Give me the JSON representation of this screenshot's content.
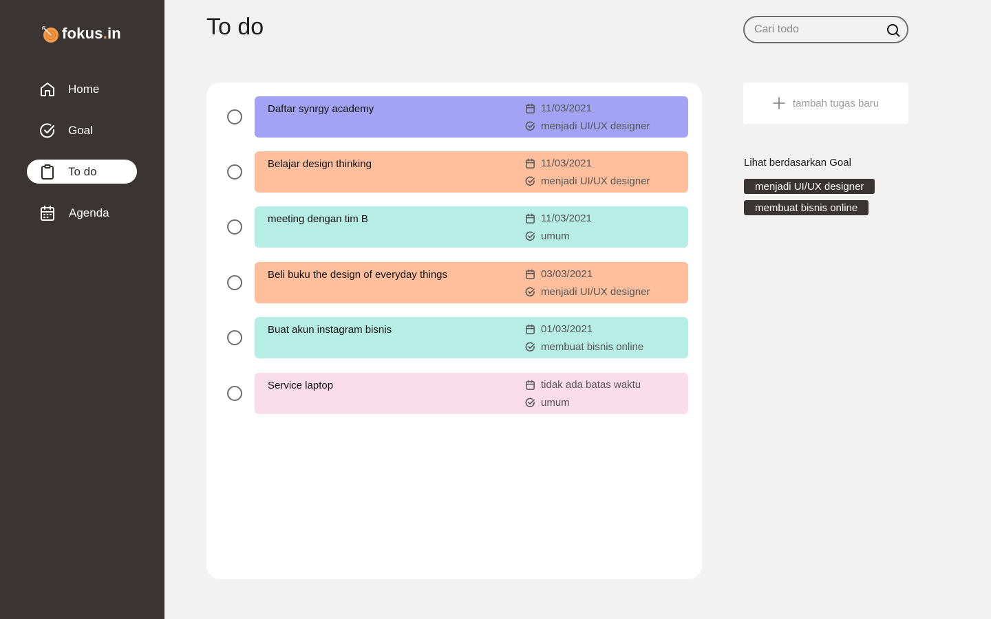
{
  "app": {
    "name_main": "fokus",
    "name_dot": ".",
    "name_suffix": "in"
  },
  "sidebar": {
    "items": [
      {
        "label": "Home",
        "icon": "home-icon",
        "active": false
      },
      {
        "label": "Goal",
        "icon": "check-circle-icon",
        "active": false
      },
      {
        "label": "To do",
        "icon": "clipboard-icon",
        "active": true
      },
      {
        "label": "Agenda",
        "icon": "calendar-icon",
        "active": false
      }
    ]
  },
  "header": {
    "title": "To do",
    "search_placeholder": "Cari todo"
  },
  "todos": [
    {
      "title": "Daftar synrgy academy",
      "date": "11/03/2021",
      "goal": "menjadi UI/UX designer",
      "color": "#a3a3f5"
    },
    {
      "title": "Belajar design thinking",
      "date": "11/03/2021",
      "goal": "menjadi UI/UX designer",
      "color": "#ffbf9d"
    },
    {
      "title": "meeting dengan tim B",
      "date": "11/03/2021",
      "goal": "umum",
      "color": "#b6ede5"
    },
    {
      "title": "Beli buku the design of everyday things",
      "date": "03/03/2021",
      "goal": "menjadi UI/UX designer",
      "color": "#ffbf9d"
    },
    {
      "title": "Buat akun instagram bisnis",
      "date": "01/03/2021",
      "goal": "membuat bisnis online",
      "color": "#b6ede5"
    },
    {
      "title": "Service laptop",
      "date": "tidak ada batas waktu",
      "goal": "umum",
      "color": "#fbdcea"
    }
  ],
  "actions": {
    "add_label": "tambah tugas baru"
  },
  "filter": {
    "title": "Lihat berdasarkan Goal",
    "goals": [
      "menjadi UI/UX designer",
      "membuat bisnis online"
    ]
  },
  "colors": {
    "sidebar_bg": "#3a3532",
    "accent": "#f2994a",
    "page_bg": "#f2f2f2"
  }
}
